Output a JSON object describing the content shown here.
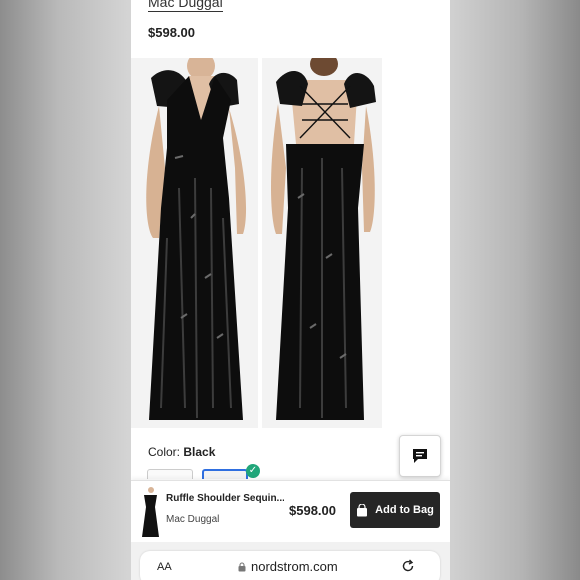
{
  "product": {
    "brand": "Mac Duggal",
    "price": "$598.00",
    "name": "Ruffle Shoulder Sequin..."
  },
  "color": {
    "label": "Color:",
    "value": "Black"
  },
  "sticky_bar": {
    "name": "Ruffle Shoulder Sequin...",
    "brand": "Mac Duggal",
    "price": "$598.00",
    "add_label": "Add to Bag"
  },
  "browser": {
    "text_size_label": "AA",
    "url": "nordstrom.com"
  },
  "icons": [
    "chat-icon",
    "bag-icon",
    "lock-icon",
    "reload-icon",
    "check-icon"
  ],
  "colors": {
    "accent_dark": "#262626",
    "selected_swatch": "#2f6fe0",
    "check_green": "#21a67a"
  }
}
